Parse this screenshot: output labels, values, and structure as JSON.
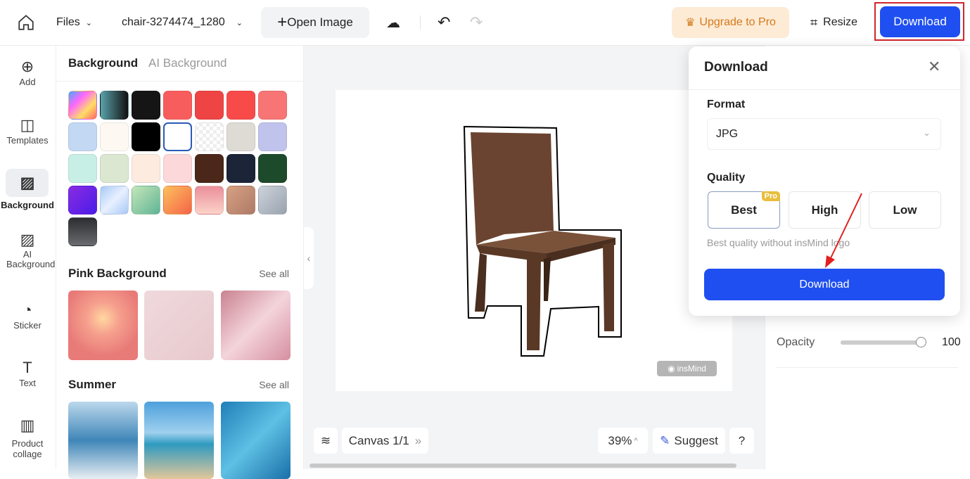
{
  "topbar": {
    "files": "Files",
    "filename": "chair-3274474_1280",
    "open_image": "Open Image",
    "upgrade": "Upgrade to Pro",
    "resize": "Resize",
    "download": "Download"
  },
  "rail": [
    {
      "label": "Add",
      "icon": "⊕"
    },
    {
      "label": "Templates",
      "icon": "◫"
    },
    {
      "label": "Background",
      "icon": "▨"
    },
    {
      "label": "AI Background",
      "icon": "▨"
    },
    {
      "label": "Sticker",
      "icon": "◔"
    },
    {
      "label": "Text",
      "icon": "T"
    },
    {
      "label": "Product collage",
      "icon": "▥"
    }
  ],
  "panel": {
    "tab_active": "Background",
    "tab_other": "AI Background",
    "swatches": [
      "linear-gradient(135deg,#4af,#f6f,#fd6,#f66)",
      "linear-gradient(90deg,#5aa3ab,#111)",
      "#151515",
      "#f85d5d",
      "#ee4444",
      "#f94a4a",
      "#f87575",
      "#c2d8f3",
      "#fdf9f2",
      "#000000",
      "#ffffff",
      "transparent",
      "#dedbd5",
      "#c0c4ec",
      "#c7efe6",
      "#dbe7d1",
      "#fdebdf",
      "#fcd8da",
      "#4a2718",
      "#1c2537",
      "#1d4a2a",
      "linear-gradient(135deg,#8a2be2,#4a1de8)",
      "linear-gradient(135deg,#a8c8f5,#e8f0ff,#a8c8f5)",
      "linear-gradient(135deg,#c5e6b9,#5fb496)",
      "linear-gradient(135deg,#fcc15a,#f5634b)",
      "linear-gradient(180deg,#ea8e9a,#fcd3c9)",
      "linear-gradient(135deg,#d7a183,#ad7a67)",
      "linear-gradient(135deg,#cdd3dc,#99a2ae)",
      "linear-gradient(180deg,#2b2d31,#6a6b6f)"
    ],
    "pink_title": "Pink Background",
    "summer_title": "Summer",
    "see_all": "See all"
  },
  "bottom": {
    "canvas": "Canvas 1/1",
    "zoom": "39%",
    "suggest": "Suggest",
    "help": "?"
  },
  "watermark": "insMind",
  "right": {
    "opacity_label": "Opacity",
    "opacity_value": "100",
    "opacity": 100
  },
  "popup": {
    "title": "Download",
    "format_label": "Format",
    "format_value": "JPG",
    "quality_label": "Quality",
    "qualities": [
      "Best",
      "High",
      "Low"
    ],
    "selected": "Best",
    "pro_badge": "Pro",
    "hint": "Best quality without insMind logo",
    "download": "Download"
  },
  "colors": {
    "accent": "#1f4ff0",
    "highlight": "#d0262d",
    "arrow": "#e02020"
  }
}
